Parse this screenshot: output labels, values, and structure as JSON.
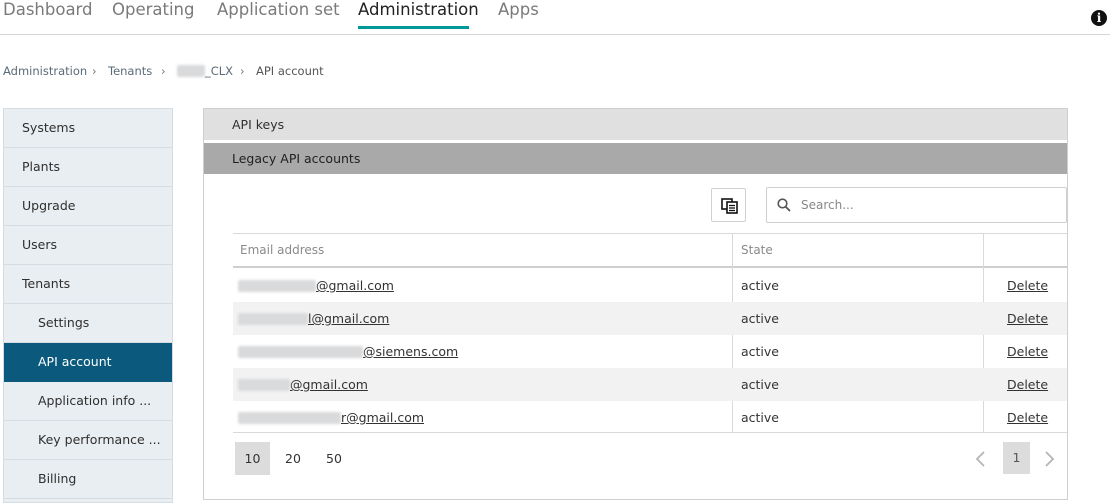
{
  "nav": {
    "tabs": [
      {
        "label": "Dashboard"
      },
      {
        "label": "Operating"
      },
      {
        "label": "Application set"
      },
      {
        "label": "Administration"
      },
      {
        "label": "Apps"
      }
    ],
    "active_tab": "Administration",
    "info_icon": "info-icon"
  },
  "breadcrumb": {
    "items": [
      "Administration",
      "Tenants",
      "_CLX",
      "API account"
    ]
  },
  "sidebar": {
    "items": [
      {
        "label": "Systems"
      },
      {
        "label": "Plants"
      },
      {
        "label": "Upgrade"
      },
      {
        "label": "Users"
      },
      {
        "label": "Tenants"
      },
      {
        "label": "Settings"
      },
      {
        "label": "API account"
      },
      {
        "label": "Application info ..."
      },
      {
        "label": "Key performance ..."
      },
      {
        "label": "Billing"
      }
    ],
    "active_item": "API account"
  },
  "main": {
    "sections": [
      "API keys",
      "Legacy API accounts"
    ],
    "search": {
      "placeholder": "Search...",
      "value": ""
    },
    "export_icon": "export-icon",
    "table": {
      "columns": [
        "Email address",
        "State",
        ""
      ],
      "rows": [
        {
          "email": "@gmail.com",
          "state": "active",
          "action": "Delete"
        },
        {
          "email": "l@gmail.com",
          "state": "active",
          "action": "Delete"
        },
        {
          "email": "@siemens.com",
          "state": "active",
          "action": "Delete"
        },
        {
          "email": "@gmail.com",
          "state": "active",
          "action": "Delete"
        },
        {
          "email": "r@gmail.com",
          "state": "active",
          "action": "Delete"
        }
      ]
    },
    "pagination": {
      "page_sizes": [
        "10",
        "20",
        "50"
      ],
      "selected_size": "10",
      "current_page": "1"
    }
  },
  "colors": {
    "accent": "#009999",
    "sidebar_active": "#0b5a7d",
    "sidebar_bg": "#e9eef2"
  }
}
